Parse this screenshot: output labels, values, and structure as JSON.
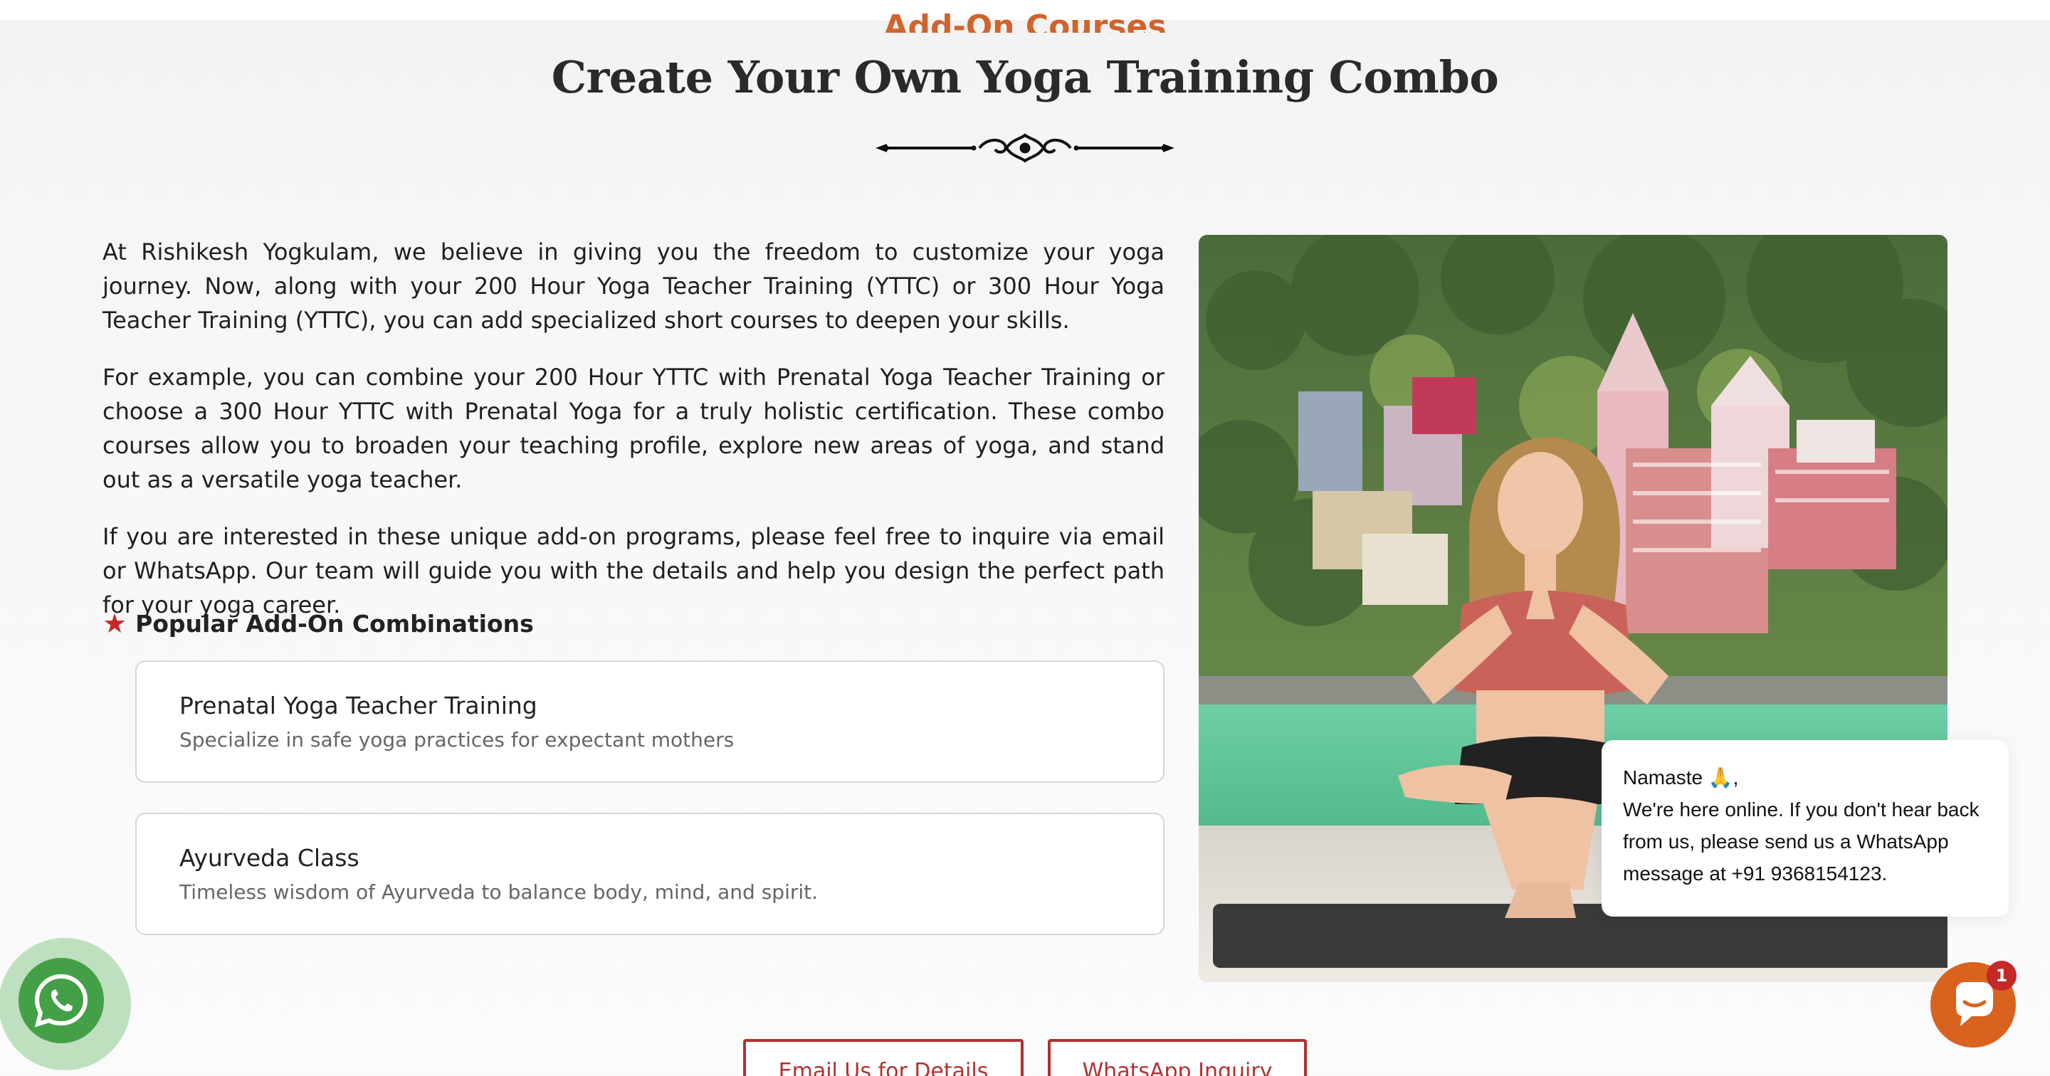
{
  "section": {
    "eyebrow": "Add-On Courses",
    "title": "Create Your Own Yoga Training Combo"
  },
  "intro": {
    "paragraphs": [
      "At Rishikesh Yogkulam, we believe in giving you the freedom to customize your yoga journey. Now, along with your 200 Hour Yoga Teacher Training (YTTC) or 300 Hour Yoga Teacher Training (YTTC), you can add specialized short courses to deepen your skills.",
      "For example, you can combine your 200 Hour YTTC with Prenatal Yoga Teacher Training or choose a 300 Hour YTTC with Prenatal Yoga for a truly holistic certification. These combo courses allow you to broaden your teaching profile, explore new areas of yoga, and stand out as a versatile yoga teacher.",
      "If you are interested in these unique add-on programs, please feel free to inquire via email or WhatsApp. Our team will guide you with the details and help you design the perfect path for your yoga career."
    ]
  },
  "popular": {
    "heading": "Popular Add-On Combinations",
    "icon": "star-icon",
    "cards": [
      {
        "title": "Prenatal Yoga Teacher Training",
        "desc": "Specialize in safe yoga practices for expectant mothers"
      },
      {
        "title": "Ayurveda Class",
        "desc": "Timeless wisdom of Ayurveda to balance body, mind, and spirit."
      }
    ]
  },
  "cta": {
    "email_label": "Email Us for Details",
    "whatsapp_label": "WhatsApp Inquiry"
  },
  "chat": {
    "line1": "Namaste 🙏,",
    "line2": "We're here online. If you don't hear back",
    "line3": "from us, please send us a WhatsApp",
    "line4": "message at +91 9368154123.",
    "badge_count": "1"
  },
  "colors": {
    "accent_orange": "#d0642c",
    "accent_red": "#b23030",
    "whatsapp_green": "#43a047",
    "chat_orange": "#d9621f"
  }
}
